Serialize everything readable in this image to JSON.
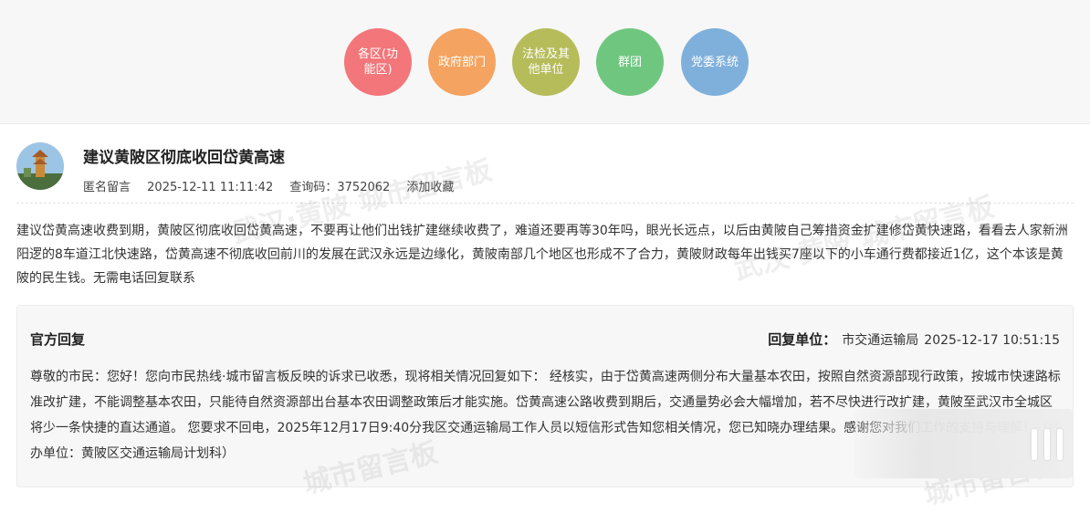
{
  "categories": [
    {
      "label": "各区(功能区)",
      "color": "#f2767a"
    },
    {
      "label": "政府部门",
      "color": "#f5a360"
    },
    {
      "label": "法检及其他单位",
      "color": "#b6bc5a"
    },
    {
      "label": "群团",
      "color": "#6fc77f"
    },
    {
      "label": "党委系统",
      "color": "#7fb0dc"
    }
  ],
  "post": {
    "title": "建议黄陂区彻底收回岱黄高速",
    "author": "匿名留言",
    "datetime": "2025-12-11 11:11:42",
    "query_code": "查询码：3752062",
    "favorite_label": "添加收藏",
    "content": "建议岱黄高速收费到期，黄陂区彻底收回岱黄高速，不要再让他们出钱扩建继续收费了，难道还要再等30年吗，眼光长远点，以后由黄陂自己筹措资金扩建修岱黄快速路，看看去人家新洲阳逻的8车道江北快速路，岱黄高速不彻底收回前川的发展在武汉永远是边缘化，黄陂南部几个地区也形成不了合力，黄陂财政每年出钱买7座以下的小车通行费都接近1亿，这个本该是黄陂的民生钱。无需电话回复联系"
  },
  "reply": {
    "heading": "官方回复",
    "unit_label": "回复单位：",
    "unit": "市交通运输局",
    "datetime": "2025-12-17 10:51:15",
    "body": "尊敬的市民：您好！您向市民热线·城市留言板反映的诉求已收悉，现将相关情况回复如下： 经核实，由于岱黄高速两侧分布大量基本农田，按照自然资源部现行政策，按城市快速路标准改扩建，不能调整基本农田，只能待自然资源部出台基本农田调整政策后才能实施。岱黄高速公路收费到期后，交通量势必会大幅增加，若不尽快进行改扩建，黄陂至武汉市全城区将少一条快捷的直达通道。 您要求不回电，2025年12月17日9:40分我区交通运输局工作人员以短信形式告知您相关情况，您已知晓办理结果。感谢您对我们工作的支持与理解！（经办单位：黄陂区交通运输局计划科）"
  },
  "watermark": {
    "text1": "武汉·黄陂 城市留言板",
    "text2": "武汉·黄陂 城市留言板",
    "text3": "城市留言板",
    "text4": "城市留言板"
  }
}
